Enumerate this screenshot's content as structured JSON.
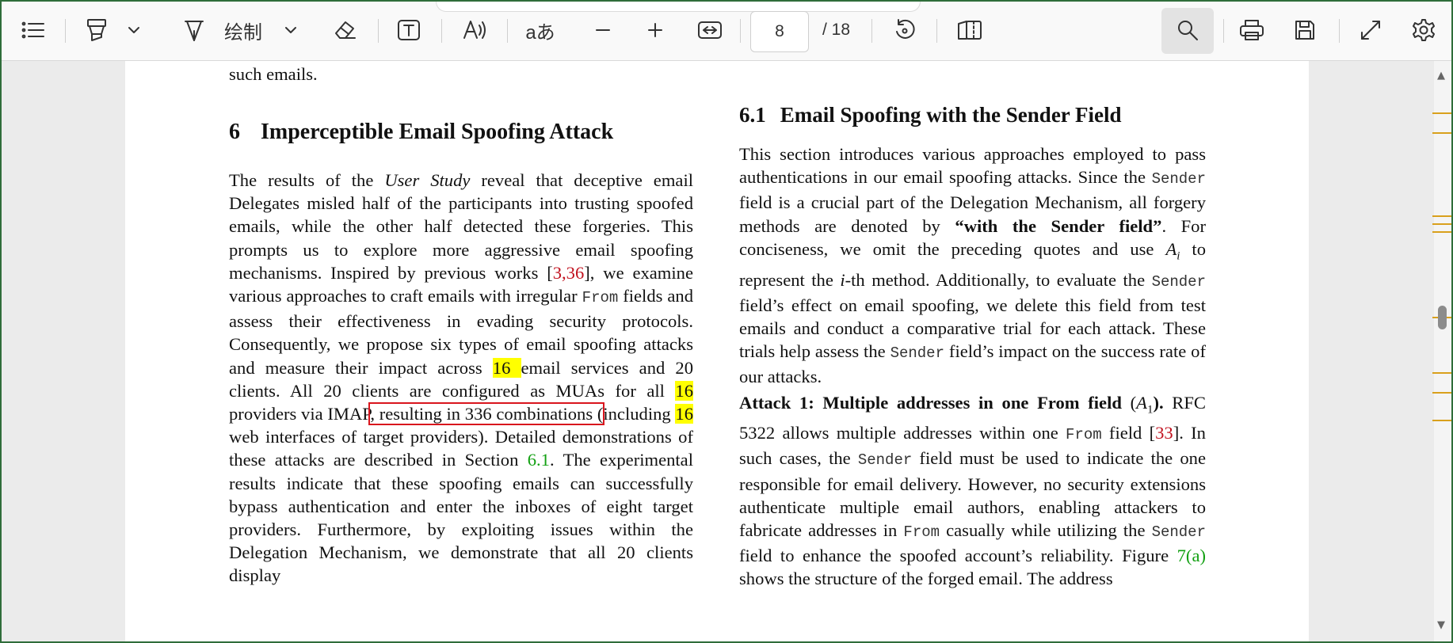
{
  "toolbar": {
    "draw_label": "绘制",
    "text_size_label": "aあ",
    "page_number": "8",
    "page_total": "/ 18",
    "icons": [
      "list-icon",
      "highlighter-icon",
      "chevron-down-icon",
      "pen-icon",
      "chevron-down-icon",
      "eraser-icon",
      "text-box-icon",
      "read-aloud-icon",
      "minus-icon",
      "plus-icon",
      "fit-width-icon",
      "rotate-icon",
      "two-page-icon",
      "search-icon",
      "print-icon",
      "save-icon",
      "fullscreen-icon",
      "settings-icon"
    ]
  },
  "document": {
    "left": {
      "top_line": "such emails.",
      "heading_num": "6",
      "heading_text": "Imperceptible Email Spoofing Attack",
      "p_a": "The results of the ",
      "p_user_study": "User Study",
      "p_b": " reveal that deceptive email Delegates misled half of the participants into trusting spoofed emails, while the other half detected these forgeries. This prompts us to explore more aggressive email spoofing mechanisms. Inspired by previous works [",
      "ref_3": "3",
      "comma": ",",
      "ref_36": "36",
      "p_c": "], we examine various approaches to craft emails with irregular ",
      "from_code": "From",
      "p_d": " fields and assess their effectiveness in evading security protocols. Consequently, we propose six types of email spoofing attacks and measure their impact across ",
      "hl_16a": "16 ",
      "p_e": "email services and 20 clients. All 20 clients are configured as MUAs for all ",
      "hl_16b": "16 ",
      "p_f": "providers via IMAP",
      "boxed_text": ", resulting in 336 combinations (",
      "p_g": "including ",
      "hl_16c": "16 ",
      "p_h": "web interfaces of target providers). Detailed demonstrations of these attacks are described in Section ",
      "sec_61": "6.1",
      "p_i": ". The experimental results indicate that these spoofing emails can successfully bypass authentication and enter the inboxes of eight target providers. Furthermore, by exploiting issues within the Delegation Mechanism, we demonstrate that all 20 clients display"
    },
    "right": {
      "heading_num": "6.1",
      "heading_text": "Email Spoofing with the Sender Field",
      "p1_a": "This section introduces various approaches employed to pass authentications in our email spoofing attacks. Since the ",
      "sender_1": "Sender",
      "p1_b": " field is a crucial part of the Delegation Mechanism, all forgery methods are denoted by ",
      "bold_quote": "“with the Sender field”",
      "p1_c": ". For conciseness, we omit the preceding quotes and use ",
      "a_i_base": "A",
      "a_i_sub": "i",
      "p1_d": " to represent the ",
      "i_ital": "i",
      "p1_e": "-th method. Additionally, to evaluate the ",
      "sender_2": "Sender",
      "p1_f": " field’s effect on email spoofing, we delete this field from test emails and conduct a comparative trial for each attack. These trials help assess the ",
      "sender_3": "Sender",
      "p1_g": " field’s impact on the success rate of our attacks.",
      "attack_title": "Attack 1: Multiple addresses in one From field",
      "a1_base": "A",
      "a1_sub": "1",
      "p2_a": " RFC 5322 allows multiple addresses within one ",
      "from_code": "From",
      "p2_b": " field [",
      "ref_33": "33",
      "p2_c": "]. In such cases, the ",
      "sender_4": "Sender",
      "p2_d": " field must be used to indicate the one responsible for email delivery. However, no security extensions authenticate multiple email authors, enabling attackers to fabricate addresses in ",
      "from_code_2": "From",
      "p2_e": " casually while utilizing the ",
      "sender_5": "Sender",
      "p2_f": " field to enhance the spoofed account’s reliability. Figure ",
      "fig_7a": "7(a)",
      "p2_g": " shows the structure of the forged email. The address"
    }
  },
  "colors": {
    "highlight": "#ffff00",
    "ref": "#c1121f",
    "section_link": "#12a012",
    "box": "#d9151d",
    "scroll_marks": "#d9a01c"
  }
}
